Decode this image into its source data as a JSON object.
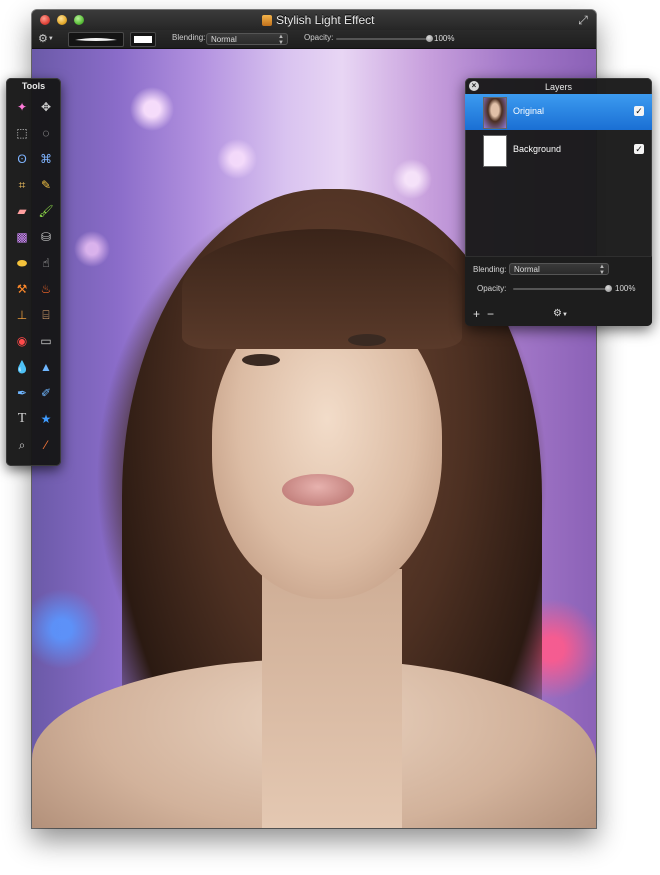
{
  "window": {
    "title": "Stylish Light Effect"
  },
  "toolbar": {
    "blending_label": "Blending:",
    "blending_value": "Normal",
    "opacity_label": "Opacity:",
    "opacity_value": "100%",
    "opacity_level": 1.0,
    "color_swatch": "#ffffff"
  },
  "tools_panel": {
    "title": "Tools",
    "tools": [
      "magic-wand",
      "move",
      "rect-select",
      "ellipse-select",
      "lasso",
      "polygon-lasso",
      "crop",
      "pencil",
      "eraser",
      "brush",
      "gradient",
      "paint-bucket",
      "sponge",
      "smudge",
      "burn",
      "dodge",
      "clone-stamp",
      "bandage",
      "red-eye",
      "blur-eraser",
      "blur",
      "sharpen",
      "pen",
      "curve-pen",
      "text",
      "shape",
      "zoom",
      "eyedropper"
    ]
  },
  "layers_panel": {
    "title": "Layers",
    "layers": [
      {
        "name": "Original",
        "visible": true,
        "selected": true
      },
      {
        "name": "Background",
        "visible": true,
        "selected": false
      }
    ],
    "blending_label": "Blending:",
    "blending_value": "Normal",
    "opacity_label": "Opacity:",
    "opacity_value": "100%",
    "opacity_level": 1.0
  }
}
